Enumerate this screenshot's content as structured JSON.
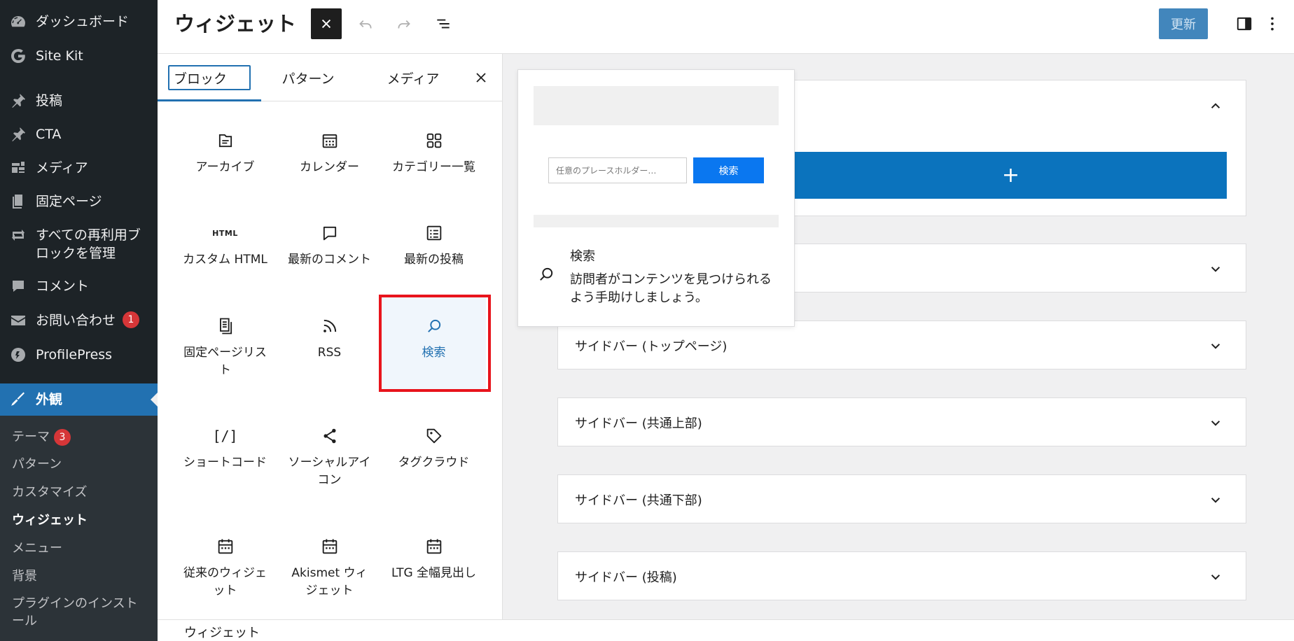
{
  "admin_menu": {
    "items": [
      {
        "label": "ダッシュボード",
        "icon": "dashboard-icon"
      },
      {
        "label": "Site Kit",
        "icon": "google-g-icon"
      },
      {
        "label": "投稿",
        "icon": "pushpin-icon"
      },
      {
        "label": "CTA",
        "icon": "pushpin-icon"
      },
      {
        "label": "メディア",
        "icon": "media-icon"
      },
      {
        "label": "固定ページ",
        "icon": "pages-icon"
      },
      {
        "label": "すべての再利用ブロックを管理",
        "line1": "すべての再利用ブ",
        "line2": "ロックを管理",
        "icon": "reuse-icon"
      },
      {
        "label": "コメント",
        "icon": "comment-icon"
      },
      {
        "label": "お問い合わせ",
        "icon": "mail-icon",
        "badge": "1"
      },
      {
        "label": "ProfilePress",
        "icon": "profilepress-icon"
      },
      {
        "label": "外観",
        "icon": "appearance-brush-icon",
        "current": true
      }
    ],
    "submenu": [
      {
        "label": "テーマ",
        "badge": "3"
      },
      {
        "label": "パターン"
      },
      {
        "label": "カスタマイズ"
      },
      {
        "label": "ウィジェット",
        "current": true
      },
      {
        "label": "メニュー"
      },
      {
        "label": "背景"
      },
      {
        "label": "プラグインのインストール",
        "line1": "プラグインのインスト",
        "line2": "ール"
      }
    ]
  },
  "header": {
    "title": "ウィジェット",
    "update_label": "更新"
  },
  "inserter": {
    "tabs": [
      "ブロック",
      "パターン",
      "メディア"
    ],
    "blocks": [
      {
        "label": "アーカイブ",
        "icon": "archive-icon"
      },
      {
        "label": "カレンダー",
        "icon": "calendar-icon"
      },
      {
        "label": "カテゴリー一覧",
        "icon": "categories-icon"
      },
      {
        "label": "カスタム HTML",
        "icon": "html-icon",
        "icon_text": "HTML"
      },
      {
        "label": "最新のコメント",
        "icon": "comment-icon"
      },
      {
        "label": "最新の投稿",
        "icon": "post-list-icon"
      },
      {
        "label": "固定ページリスト",
        "line1": "固定ページリス",
        "line2": "ト",
        "icon": "page-list-icon"
      },
      {
        "label": "RSS",
        "icon": "rss-icon"
      },
      {
        "label": "検索",
        "icon": "search-icon",
        "selected": true
      },
      {
        "label": "ショートコード",
        "icon": "shortcode-icon",
        "icon_text": "[/]"
      },
      {
        "label": "ソーシャルアイコン",
        "line1": "ソーシャルアイ",
        "line2": "コン",
        "icon": "share-icon"
      },
      {
        "label": "タグクラウド",
        "icon": "tag-icon"
      },
      {
        "label": "従来のウィジェット",
        "line1": "従来のウィジェ",
        "line2": "ット",
        "icon": "calendar-widget-icon"
      },
      {
        "label": "Akismet ウィジェット",
        "line1": "Akismet ウィ",
        "line2": "ジェット",
        "icon": "calendar-widget-icon"
      },
      {
        "label": "LTG 全幅見出し",
        "icon": "calendar-widget-icon"
      }
    ]
  },
  "preview": {
    "placeholder": "任意のプレースホルダー…",
    "button": "検索",
    "title": "検索",
    "description": "訪問者がコンテンツを見つけられるよう手助けしましょう。",
    "desc_line1": "訪問者がコンテンツを見つけられる",
    "desc_line2": "よう手助けしましょう。"
  },
  "widget_areas": [
    {
      "title": "サイドバー (トップページ)"
    },
    {
      "title": "サイドバー (共通上部)"
    },
    {
      "title": "サイドバー (共通下部)"
    },
    {
      "title": "サイドバー (投稿)"
    }
  ],
  "footer": {
    "breadcrumb": "ウィジェット"
  },
  "colors": {
    "admin_bg": "#1d2327",
    "accent": "#2271b1",
    "highlight": "#e8141c",
    "add_block": "#0b73bd",
    "preview_button": "#0a77f0"
  }
}
